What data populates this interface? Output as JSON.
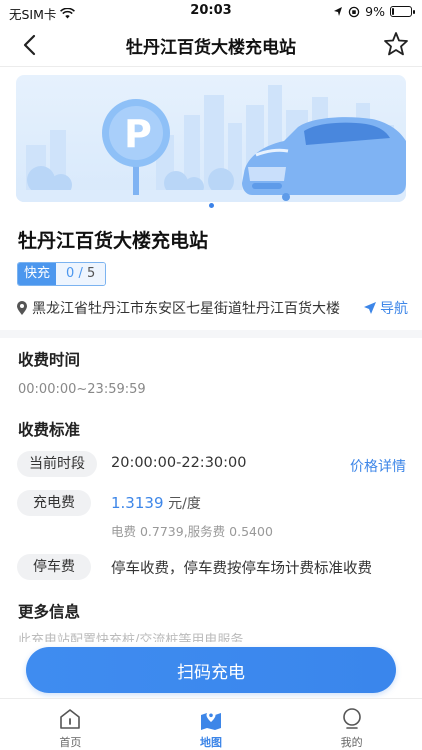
{
  "status_bar": {
    "carrier": "无SIM卡",
    "time": "20:03",
    "battery_percent": "9%",
    "battery_level": 0.09
  },
  "nav": {
    "title": "牡丹江百货大楼充电站"
  },
  "station": {
    "name": "牡丹江百货大楼充电站",
    "charge_type": "快充",
    "available": "0",
    "slash": "/",
    "total": "5",
    "address": "黑龙江省牡丹江市东安区七星街道牡丹江百货大楼",
    "navigate_label": "导航"
  },
  "charging_time": {
    "title": "收费时间",
    "hours": "00:00:00~23:59:59"
  },
  "fees": {
    "title": "收费标准",
    "current_period_label": "当前时段",
    "current_period_value": "20:00:00-22:30:00",
    "price_detail_label": "价格详情",
    "charge_fee_label": "充电费",
    "charge_fee_price": "1.3139",
    "charge_fee_unit": "元/度",
    "charge_fee_breakdown": "电费 0.7739,服务费 0.5400",
    "parking_label": "停车费",
    "parking_value": "停车收费，停车费按停车场计费标准收费"
  },
  "more_info": {
    "title": "更多信息",
    "partial_text": "此充电站配置快充桩/交流桩等用电服务"
  },
  "scan_button": "扫码充电",
  "tabs": [
    {
      "label": "首页",
      "icon": "home-icon"
    },
    {
      "label": "地图",
      "icon": "map-icon"
    },
    {
      "label": "我的",
      "icon": "profile-icon"
    }
  ],
  "colors": {
    "accent": "#3d86e8",
    "button": "#3f8cf0"
  }
}
